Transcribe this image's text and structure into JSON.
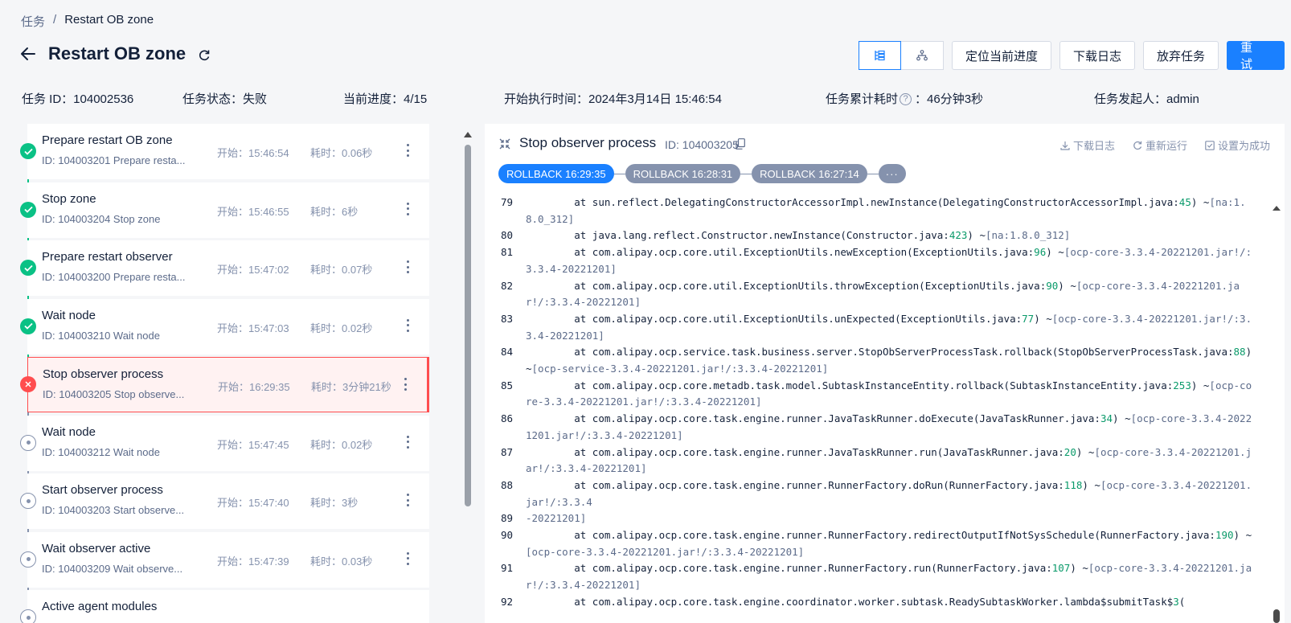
{
  "breadcrumb": {
    "parent": "任务",
    "separator": "/",
    "current": "Restart OB zone"
  },
  "header": {
    "title": "Restart OB zone"
  },
  "actions": {
    "locate": "定位当前进度",
    "download": "下载日志",
    "abandon": "放弃任务",
    "retry": "重 试"
  },
  "meta": {
    "task_id": "任务 ID：104002536",
    "status": "任务状态：失败",
    "progress": "当前进度：4/15",
    "start_time": "开始执行时间：2024年3月14日 15:46:54",
    "elapsed_label": "任务累计耗时",
    "elapsed_value": "：46分钟3秒",
    "initiator": "任务发起人：admin"
  },
  "colors": {
    "primary": "#1a80ff",
    "success": "#0ac185",
    "error": "#ff4d4f",
    "pending": "#8592ad"
  },
  "tasks": [
    {
      "name": "Prepare restart OB zone",
      "id": "ID: 104003201  Prepare resta...",
      "start": "开始：15:46:54",
      "duration": "耗时：0.06秒",
      "status": "success"
    },
    {
      "name": "Stop zone",
      "id": "ID: 104003204  Stop zone",
      "start": "开始：15:46:55",
      "duration": "耗时：6秒",
      "status": "success"
    },
    {
      "name": "Prepare restart observer",
      "id": "ID: 104003200  Prepare resta...",
      "start": "开始：15:47:02",
      "duration": "耗时：0.07秒",
      "status": "success"
    },
    {
      "name": "Wait node",
      "id": "ID: 104003210  Wait node",
      "start": "开始：15:47:03",
      "duration": "耗时：0.02秒",
      "status": "success"
    },
    {
      "name": "Stop observer process",
      "id": "ID: 104003205  Stop observe...",
      "start": "开始：16:29:35",
      "duration": "耗时：3分钟21秒",
      "status": "fail"
    },
    {
      "name": "Wait node",
      "id": "ID: 104003212  Wait node",
      "start": "开始：15:47:45",
      "duration": "耗时：0.02秒",
      "status": "pending"
    },
    {
      "name": "Start observer process",
      "id": "ID: 104003203  Start observe...",
      "start": "开始：15:47:40",
      "duration": "耗时：3秒",
      "status": "pending"
    },
    {
      "name": "Wait observer active",
      "id": "ID: 104003209  Wait observe...",
      "start": "开始：15:47:39",
      "duration": "耗时：0.03秒",
      "status": "pending"
    },
    {
      "name": "Active agent modules",
      "id": "",
      "start": "",
      "duration": "",
      "status": "pending"
    }
  ],
  "detail": {
    "title": "Stop observer process",
    "id": "ID: 104003205",
    "download": "下载日志",
    "rerun": "重新运行",
    "mark_success": "设置为成功",
    "tags": [
      "ROLLBACK 16:29:35",
      "ROLLBACK 16:28:31",
      "ROLLBACK 16:27:14"
    ],
    "tags_more": "···"
  },
  "log": [
    {
      "ln": "79",
      "parts": [
        "        at sun.reflect.DelegatingConstructorAccessorImpl.newInstance(DelegatingConstructorAccessorImpl.java:",
        "45",
        ") ~",
        "[na:1.8.0_312]"
      ]
    },
    {
      "ln": "80",
      "parts": [
        "        at java.lang.reflect.Constructor.newInstance(Constructor.java:",
        "423",
        ") ~",
        "[na:1.8.0_312]"
      ]
    },
    {
      "ln": "81",
      "parts": [
        "        at com.alipay.ocp.core.util.ExceptionUtils.newException(ExceptionUtils.java:",
        "96",
        ") ~",
        "[ocp-core-3.3.4-20221201.jar!/:3.3.4-20221201]"
      ]
    },
    {
      "ln": "82",
      "parts": [
        "        at com.alipay.ocp.core.util.ExceptionUtils.throwException(ExceptionUtils.java:",
        "90",
        ") ~",
        "[ocp-core-3.3.4-20221201.jar!/:3.3.4-20221201]"
      ]
    },
    {
      "ln": "83",
      "parts": [
        "        at com.alipay.ocp.core.util.ExceptionUtils.unExpected(ExceptionUtils.java:",
        "77",
        ") ~",
        "[ocp-core-3.3.4-20221201.jar!/:3.3.4-20221201]"
      ]
    },
    {
      "ln": "84",
      "parts": [
        "        at com.alipay.ocp.service.task.business.server.StopObServerProcessTask.rollback(StopObServerProcessTask.java:",
        "88",
        ") ~",
        "[ocp-service-3.3.4-20221201.jar!/:3.3.4-20221201]"
      ]
    },
    {
      "ln": "85",
      "parts": [
        "        at com.alipay.ocp.core.metadb.task.model.SubtaskInstanceEntity.rollback(SubtaskInstanceEntity.java:",
        "253",
        ") ~",
        "[ocp-core-3.3.4-20221201.jar!/:3.3.4-20221201]"
      ]
    },
    {
      "ln": "86",
      "parts": [
        "        at com.alipay.ocp.core.task.engine.runner.JavaTaskRunner.doExecute(JavaTaskRunner.java:",
        "34",
        ") ~",
        "[ocp-core-3.3.4-20221201.jar!/:3.3.4-20221201]"
      ]
    },
    {
      "ln": "87",
      "parts": [
        "        at com.alipay.ocp.core.task.engine.runner.JavaTaskRunner.run(JavaTaskRunner.java:",
        "20",
        ") ~",
        "[ocp-core-3.3.4-20221201.jar!/:3.3.4-20221201]"
      ]
    },
    {
      "ln": "88",
      "parts": [
        "        at com.alipay.ocp.core.task.engine.runner.RunnerFactory.doRun(RunnerFactory.java:",
        "118",
        ") ~",
        "[ocp-core-3.3.4-20221201.jar!/:3.3.4"
      ]
    },
    {
      "ln": "89",
      "parts": [
        "",
        "",
        "",
        "-20221201]"
      ]
    },
    {
      "ln": "90",
      "parts": [
        "        at com.alipay.ocp.core.task.engine.runner.RunnerFactory.redirectOutputIfNotSysSchedule(RunnerFactory.java:",
        "190",
        ") ~",
        "[ocp-core-3.3.4-20221201.jar!/:3.3.4-20221201]"
      ]
    },
    {
      "ln": "91",
      "parts": [
        "        at com.alipay.ocp.core.task.engine.runner.RunnerFactory.run(RunnerFactory.java:",
        "107",
        ") ~",
        "[ocp-core-3.3.4-20221201.jar!/:3.3.4-20221201]"
      ]
    },
    {
      "ln": "92",
      "parts": [
        "        at com.alipay.ocp.core.task.engine.coordinator.worker.subtask.ReadySubtaskWorker.lambda$submitTask$",
        "3",
        "(",
        ""
      ]
    }
  ]
}
